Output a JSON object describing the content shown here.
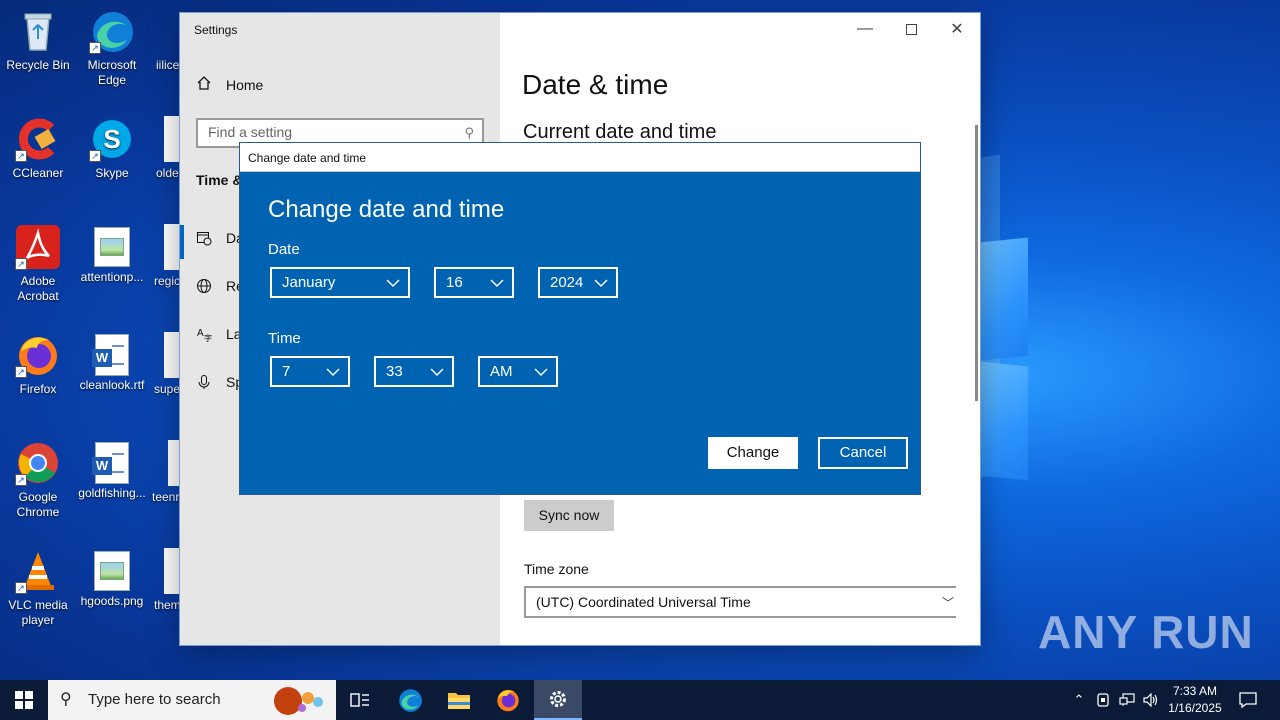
{
  "desktop": {
    "icons": [
      {
        "label": "Recycle Bin"
      },
      {
        "label": "Microsoft Edge"
      },
      {
        "label": "iilice"
      },
      {
        "label": "CCleaner"
      },
      {
        "label": "Skype"
      },
      {
        "label": "olde"
      },
      {
        "label": "Adobe Acrobat"
      },
      {
        "label": "attentionp..."
      },
      {
        "label": "regic"
      },
      {
        "label": "Firefox"
      },
      {
        "label": "cleanlook.rtf"
      },
      {
        "label": "supe"
      },
      {
        "label": "Google Chrome"
      },
      {
        "label": "goldfishing..."
      },
      {
        "label": "teenr"
      },
      {
        "label": "VLC media player"
      },
      {
        "label": "hgoods.png"
      },
      {
        "label": "them"
      }
    ],
    "watermark": "ANY RUN"
  },
  "settings": {
    "title": "Settings",
    "home_label": "Home",
    "search_placeholder": "Find a setting",
    "category_heading": "Time &",
    "nav_items": [
      {
        "label": "Da",
        "icon": "calendar-clock-icon"
      },
      {
        "label": "Re",
        "icon": "globe-icon"
      },
      {
        "label": "La",
        "icon": "language-icon"
      },
      {
        "label": "Sp",
        "icon": "microphone-icon"
      }
    ],
    "page_title": "Date & time",
    "section_title": "Current date and time",
    "sync_button": "Sync now",
    "time_zone_label": "Time zone",
    "time_zone_value": "(UTC) Coordinated Universal Time"
  },
  "dialog": {
    "window_title": "Change date and time",
    "heading": "Change date and time",
    "date_label": "Date",
    "month": "January",
    "day": "16",
    "year": "2024",
    "time_label": "Time",
    "hour": "7",
    "minute": "33",
    "ampm": "AM",
    "change_button": "Change",
    "cancel_button": "Cancel",
    "background_color": "#0063b1"
  },
  "taskbar": {
    "search_placeholder": "Type here to search",
    "clock_time": "7:33 AM",
    "clock_date": "1/16/2025"
  }
}
